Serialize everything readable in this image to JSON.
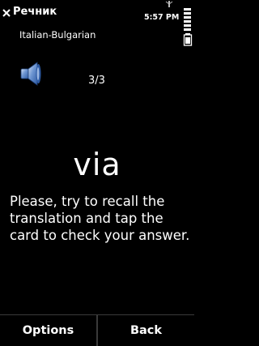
{
  "status_bar": {
    "app_title": "Речник",
    "time": "5:57 PM",
    "close_icon": "close-icon",
    "signal_icon": "signal-icon",
    "battery_icon": "battery-icon"
  },
  "card": {
    "language_pair": "Italian-Bulgarian",
    "counter": "3/3",
    "word": "via",
    "instruction": "Please, try to recall the translation and tap the card to check your answer.",
    "speaker_icon": "speaker-icon"
  },
  "softkeys": {
    "left_label": "Options",
    "right_label": "Back"
  },
  "colors": {
    "background": "#000000",
    "text": "#ffffff",
    "speaker_blue": "#4f7ec9"
  }
}
